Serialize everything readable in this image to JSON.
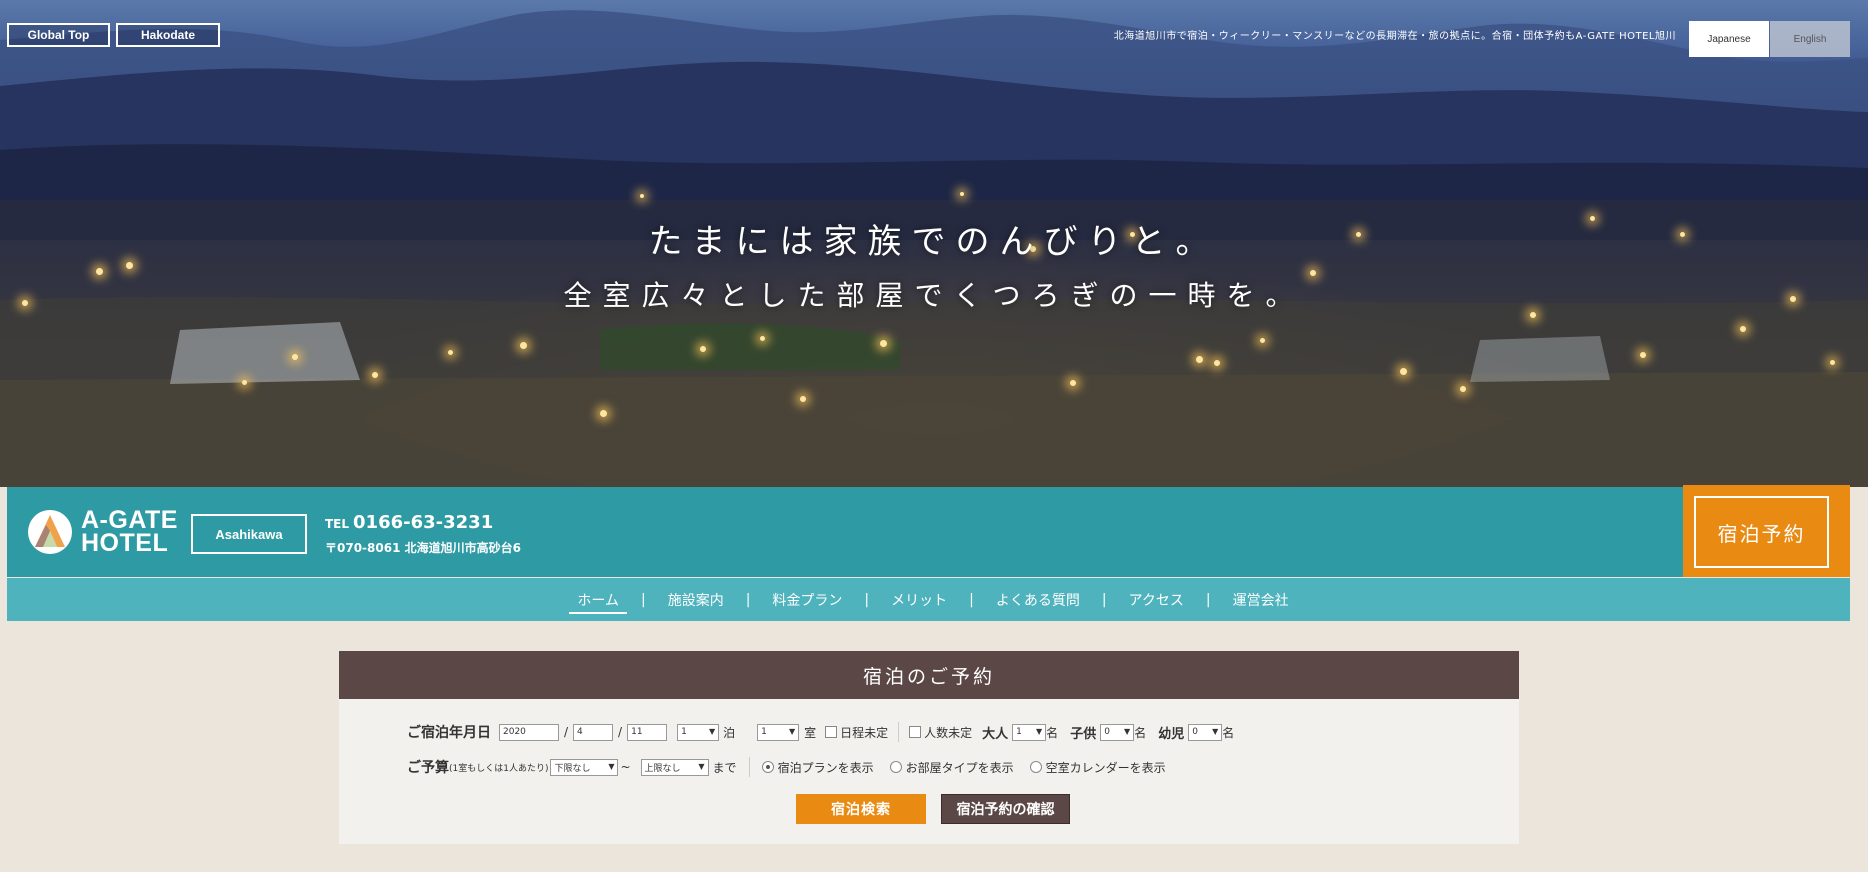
{
  "top_buttons": {
    "global_top": "Global Top",
    "hakodate": "Hakodate"
  },
  "tagline": "北海道旭川市で宿泊・ウィークリー・マンスリーなどの長期滞在・旅の拠点に。合宿・団体予約もA-GATE HOTEL旭川",
  "languages": {
    "japanese": "Japanese",
    "english": "English"
  },
  "hero": {
    "line1": "たまには家族でのんびりと。",
    "line2": "全室広々とした部屋でくつろぎの一時を。"
  },
  "header": {
    "logo_line1": "A-GATE",
    "logo_line2": "HOTEL",
    "branch": "Asahikawa",
    "tel_label": "TEL",
    "tel_number": "0166-63-3231",
    "address": "〒070-8061 北海道旭川市高砂台6",
    "reserve_button": "宿泊予約",
    "colors": {
      "band": "#2e9aa3",
      "nav": "#4fb3bd",
      "accent": "#e98a12",
      "panel_head": "#5b4846"
    }
  },
  "nav": {
    "items": [
      {
        "label": "ホーム",
        "active": true
      },
      {
        "label": "施設案内"
      },
      {
        "label": "料金プラン"
      },
      {
        "label": "メリット"
      },
      {
        "label": "よくある質問"
      },
      {
        "label": "アクセス"
      },
      {
        "label": "運営会社"
      }
    ],
    "separator": "|"
  },
  "reservation": {
    "title": "宿泊のご予約",
    "date_label": "ご宿泊年月日",
    "year": "2020",
    "month": "4",
    "day": "11",
    "slash": "/",
    "nights": "1",
    "nights_unit": "泊",
    "rooms": "1",
    "rooms_unit": "室",
    "date_undecided": "日程未定",
    "people_undecided": "人数未定",
    "adult_label": "大人",
    "adult": "1",
    "child_label": "子供",
    "child": "0",
    "infant_label": "幼児",
    "infant": "0",
    "person_unit": "名",
    "budget_label": "ご予算",
    "budget_note": "(1室もしくは1人あたり)",
    "budget_min": "下限なし",
    "budget_dash": "~",
    "budget_max": "上限なし",
    "budget_until": "まで",
    "radio_plan": "宿泊プランを表示",
    "radio_room": "お部屋タイプを表示",
    "radio_calendar": "空室カレンダーを表示",
    "search_button": "宿泊検索",
    "confirm_button": "宿泊予約の確認"
  }
}
